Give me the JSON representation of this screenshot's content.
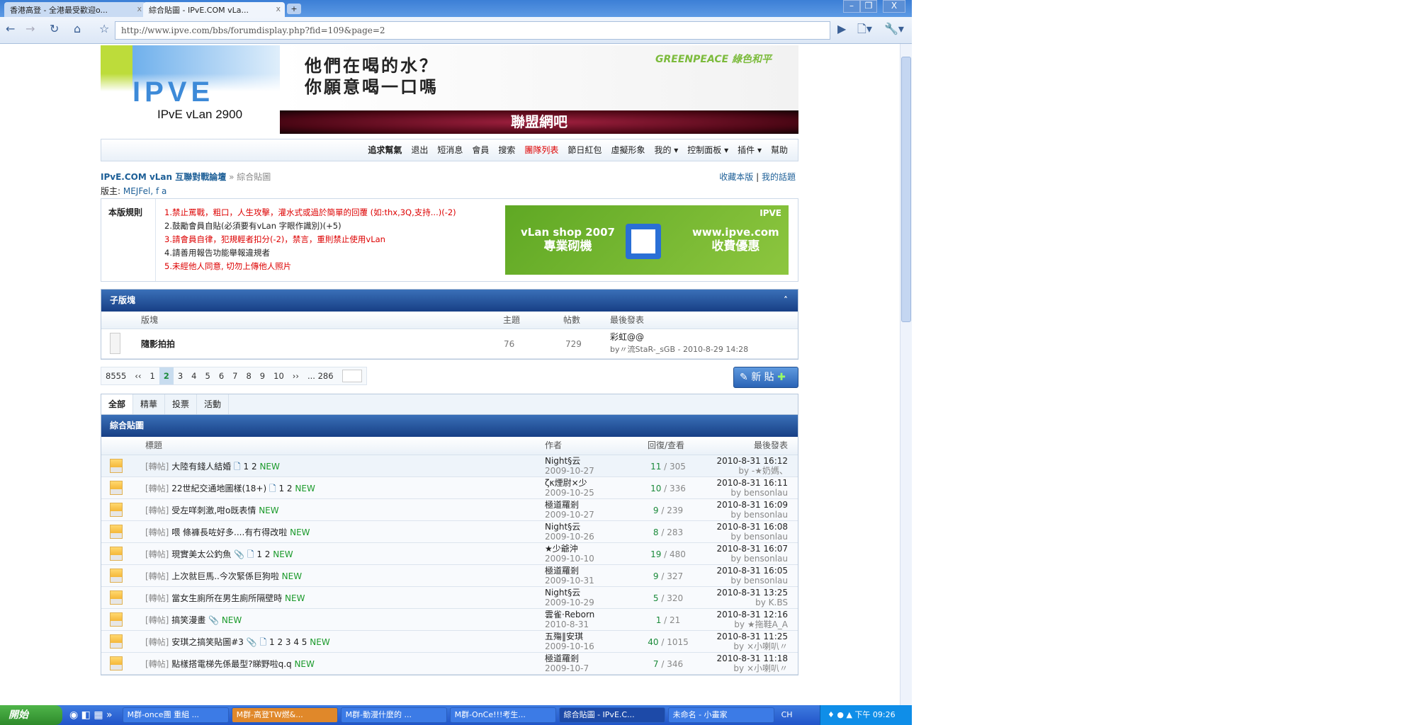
{
  "browser": {
    "tabs": [
      "香港高登 - 全港最受歡迎o...",
      "綜合貼圖 - IPvE.COM vLa..."
    ],
    "url": "http://www.ipve.com/bbs/forumdisplay.php?fid=109&page=2"
  },
  "header": {
    "logo": "IPVE",
    "logo_sub": "IPvE vLan 2900",
    "ad_line1": "他們在喝的水？",
    "ad_line2": "你願意喝一口嗎",
    "ad_brand": "GREENPEACE 綠色和平",
    "ad2": "聯盟網吧"
  },
  "nav": [
    "追求幫氣",
    "退出",
    "短消息",
    "會員",
    "搜索",
    "團隊列表",
    "節日紅包",
    "虛擬形象",
    "我的 ▾",
    "控制面板 ▾",
    "插件 ▾",
    "幫助"
  ],
  "breadcrumb": {
    "home": "IPvE.COM vLan 互聯對戰論壇",
    "sep": "»",
    "current": "綜合貼圖",
    "moderator_label": "版主:",
    "moderators": "MEJFel, f a",
    "fav": "收藏本版",
    "mytopics": "我的話題"
  },
  "rules": {
    "label": "本版規則",
    "items": [
      "1.禁止罵戰，粗口，人生攻擊，灌水式或過於簡單的回覆 (如:thx,3Q,支持...)(-2)",
      "2.鼓勵會員自貼(必須要有vLan 字眼作識別)(+5)",
      "3.請會員自律，犯規輕者扣分(-2)，禁言，重則禁止使用vLan",
      "4.請善用報告功能舉報違規者",
      "5.未經他人同意, 切勿上傳他人照片"
    ],
    "ad_left1": "vLan shop 2007",
    "ad_left2": "專業砌機",
    "ad_right1": "www.ipve.com",
    "ad_right2": "收費優惠",
    "ad_logo": "IPVE"
  },
  "subforum": {
    "title": "子版塊",
    "cols": [
      "版塊",
      "主題",
      "帖數",
      "最後發表"
    ],
    "row": {
      "name": "隨影拍拍",
      "topics": "76",
      "posts": "729",
      "last_title": "彩虹@@",
      "last_by": "by〃流StaR-_sGB - 2010-8-29 14:28"
    }
  },
  "pager": {
    "total": "8555",
    "prev": "‹‹",
    "pages": [
      "1",
      "2",
      "3",
      "4",
      "5",
      "6",
      "7",
      "8",
      "9",
      "10"
    ],
    "current": "2",
    "next": "››",
    "last": "... 286",
    "new_post": "新 貼"
  },
  "tabs": [
    "全部",
    "精華",
    "投票",
    "活動"
  ],
  "threads": {
    "title": "綜合貼圖",
    "cols": [
      "標題",
      "作者",
      "回復/查看",
      "最後發表"
    ],
    "rows": [
      {
        "tag": "[轉帖]",
        "title": "大陸有錢人結婚",
        "pages": "1  2",
        "author": "Night§云",
        "date": "2009-10-27",
        "replies": "11",
        "views": "305",
        "last": "2010-8-31 16:12",
        "by": "by -★奶媽、"
      },
      {
        "tag": "[轉帖]",
        "title": "22世紀交通地圖樣(18+)",
        "pages": "1  2",
        "author": "ζκ煙尉×少",
        "date": "2009-10-25",
        "replies": "10",
        "views": "336",
        "last": "2010-8-31 16:11",
        "by": "by bensonlau"
      },
      {
        "tag": "[轉帖]",
        "title": "受左咩刺激,咁o既表情",
        "pages": "",
        "author": "極道羅剎",
        "date": "2009-10-27",
        "replies": "9",
        "views": "239",
        "last": "2010-8-31 16:09",
        "by": "by bensonlau"
      },
      {
        "tag": "[轉帖]",
        "title": "喂 條褲長咗好多....有冇得改啦",
        "pages": "",
        "author": "Night§云",
        "date": "2009-10-26",
        "replies": "8",
        "views": "283",
        "last": "2010-8-31 16:08",
        "by": "by bensonlau"
      },
      {
        "tag": "[轉帖]",
        "title": "現實美太公釣魚",
        "pages": "1  2",
        "author": "★少爺沖",
        "date": "2009-10-10",
        "replies": "19",
        "views": "480",
        "last": "2010-8-31 16:07",
        "by": "by bensonlau",
        "clip": true
      },
      {
        "tag": "[轉帖]",
        "title": "上次就巨馬..今次緊係巨狗啦",
        "pages": "",
        "author": "極道羅剎",
        "date": "2009-10-31",
        "replies": "9",
        "views": "327",
        "last": "2010-8-31 16:05",
        "by": "by bensonlau"
      },
      {
        "tag": "[轉帖]",
        "title": "當女生廁所在男生廁所隔壁時",
        "pages": "",
        "author": "Night§云",
        "date": "2009-10-29",
        "replies": "5",
        "views": "320",
        "last": "2010-8-31 13:25",
        "by": "by K.BS"
      },
      {
        "tag": "[轉帖]",
        "title": "搞笑漫畫",
        "pages": "",
        "author": "雲雀·Reborn",
        "date": "2010-8-31",
        "replies": "1",
        "views": "21",
        "last": "2010-8-31 12:16",
        "by": "by ★拖鞋A_A",
        "clip": true
      },
      {
        "tag": "[轉帖]",
        "title": "安琪之搞笑貼圖#3",
        "pages": "1  2  3  4  5",
        "author": "五殤‖安琪",
        "date": "2009-10-16",
        "replies": "40",
        "views": "1015",
        "last": "2010-8-31 11:25",
        "by": "by ×小喇叭〃",
        "clip": true
      },
      {
        "tag": "[轉帖]",
        "title": "點樣搭電梯先係最型?睇野啦q.q",
        "pages": "",
        "author": "極道羅剎",
        "date": "2009-10-7",
        "replies": "7",
        "views": "346",
        "last": "2010-8-31 11:18",
        "by": "by ×小喇叭〃"
      }
    ],
    "new_label": "NEW"
  },
  "taskbar": {
    "start": "開始",
    "tasks": [
      "M群-once團 重組 ...",
      "M群-高登TW燃&...",
      "M群-動漫什麼的 ...",
      "M群-OnCe!!!考生...",
      "綜合貼圖 - IPvE.C...",
      "未命名 - 小畫家"
    ],
    "lang": "CH",
    "clock": "下午 09:26"
  }
}
